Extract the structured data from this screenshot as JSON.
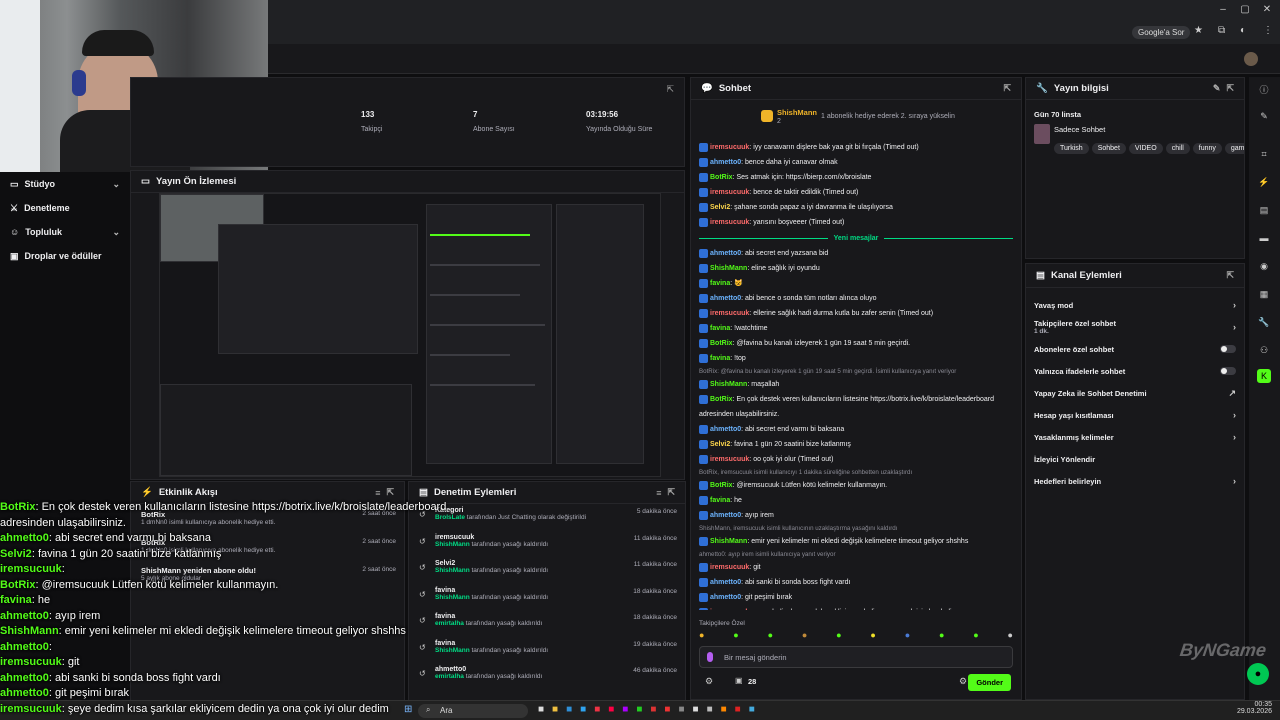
{
  "browser": {
    "google_chip": "Google'a Sor"
  },
  "nav": {
    "items": [
      {
        "label": "Stüdyo"
      },
      {
        "label": "Denetleme"
      },
      {
        "label": "Topluluk"
      },
      {
        "label": "Droplar ve ödüller"
      }
    ]
  },
  "stats": [
    {
      "value": "133",
      "label": "Takipçi"
    },
    {
      "value": "7",
      "label": "Abone Sayısı"
    },
    {
      "value": "03:19:56",
      "label": "Yayında Olduğu Süre"
    }
  ],
  "preview": {
    "title": "Yayın Ön İzlemesi"
  },
  "activity": {
    "title": "Etkinlik Akışı",
    "items": [
      {
        "title": "BotRix",
        "sub": "1 dmNn0 isimli kullanıcıya abonelik hediye etti.",
        "time": "2 saat önce"
      },
      {
        "title": "BotRix",
        "sub": "1 dmNn0 isimli kullanıcıya abonelik hediye etti.",
        "time": "2 saat önce"
      },
      {
        "title": "ShishMann yeniden abone oldu!",
        "sub": "5 aylık abone oldular",
        "time": "2 saat önce"
      }
    ]
  },
  "modlog": {
    "title": "Denetim Eylemleri",
    "rows": [
      {
        "name": "Kategori",
        "by": "BrolsLate",
        "action": "tarafından Just Chatting olarak değiştirildi",
        "time": "5 dakika önce"
      },
      {
        "name": "iremsucuuk",
        "by": "ShishMann",
        "action": "tarafından yasağı kaldırıldı",
        "time": "11 dakika önce"
      },
      {
        "name": "Selvi2",
        "by": "ShishMann",
        "action": "tarafından yasağı kaldırıldı",
        "time": "11 dakika önce"
      },
      {
        "name": "favina",
        "by": "ShishMann",
        "action": "tarafından yasağı kaldırıldı",
        "time": "18 dakika önce"
      },
      {
        "name": "favina",
        "by": "emirtalha",
        "action": "tarafından yasağı kaldırıldı",
        "time": "18 dakika önce"
      },
      {
        "name": "favina",
        "by": "ShishMann",
        "action": "tarafından yasağı kaldırıldı",
        "time": "19 dakika önce"
      },
      {
        "name": "ahmetto0",
        "by": "emirtalha",
        "action": "tarafından yasağı kaldırıldı",
        "time": "46 dakika önce"
      }
    ]
  },
  "chat": {
    "title": "Sohbet",
    "pinned_user": "ShishMann",
    "pinned_count": "2",
    "pinned_text": "1 abonelik hediye ederek 2. sıraya yükselin",
    "new_messages": "Yeni mesajlar",
    "input_placeholder": "Bir mesaj gönderin",
    "viewers": "28",
    "send_label": "Gönder",
    "followers_only": "Takipçilere Özel",
    "messages_top": [
      {
        "user": "iremsucuuk",
        "color": "#ff6b6b",
        "text": "iyy canavarın dişlere bak yaa git bi fırçala (Timed out)"
      },
      {
        "user": "ahmetto0",
        "color": "#6cb4ff",
        "text": "bence daha iyi canavar olmak"
      },
      {
        "user": "BotRix",
        "color": "#53fc18",
        "text": "Ses atmak için: https://bierp.com/x/broislate"
      },
      {
        "user": "iremsucuuk",
        "color": "#ff6b6b",
        "text": "bence de taktir edildik (Timed out)"
      },
      {
        "user": "Selvi2",
        "color": "#ffd84d",
        "text": "şahane sonda papaz a iyi davranma ile ulaşılıyorsa"
      },
      {
        "user": "iremsucuuk",
        "color": "#ff6b6b",
        "text": "yarısını boşveeer (Timed out)"
      }
    ],
    "messages_bottom": [
      {
        "user": "ahmetto0",
        "color": "#6cb4ff",
        "text": "abi secret end yazsana bid"
      },
      {
        "user": "ShishMann",
        "color": "#53fc18",
        "text": "eline sağlık iyi oyundu"
      },
      {
        "user": "favina",
        "color": "#53fc18",
        "text": "😺"
      },
      {
        "user": "ahmetto0",
        "color": "#6cb4ff",
        "text": "abi bence o sonda tüm notları alınca oluyo"
      },
      {
        "user": "iremsucuuk",
        "color": "#ff6b6b",
        "text": "ellerine sağlık hadi durma kutla bu zafer senin (Timed out)"
      },
      {
        "user": "favina",
        "color": "#53fc18",
        "text": "!watchtime"
      },
      {
        "user": "BotRix",
        "color": "#53fc18",
        "text": "@favina bu kanalı izleyerek 1 gün 19 saat 5 min geçirdi."
      },
      {
        "user": "favina",
        "color": "#53fc18",
        "text": "!top"
      },
      {
        "reply": "BotRix: @favina bu kanalı izleyerek 1 gün 19 saat 5 min geçirdi. İsimli kullanıcıya yanıt veriyor"
      },
      {
        "user": "ShishMann",
        "color": "#53fc18",
        "text": "maşallah"
      },
      {
        "user": "BotRix",
        "color": "#53fc18",
        "text": "En çok destek veren kullanıcıların listesine https://botrix.live/k/broislate/leaderboard"
      },
      {
        "text_only": "adresinden ulaşabilirsiniz."
      },
      {
        "user": "ahmetto0",
        "color": "#6cb4ff",
        "text": "abi secret end varmı bi baksana"
      },
      {
        "user": "Selvi2",
        "color": "#ffd84d",
        "text": "favina 1 gün 20 saatini bize katlanmış"
      },
      {
        "user": "iremsucuuk",
        "color": "#ff6b6b",
        "text": "oo çok iyi olur (Timed out)"
      },
      {
        "reply": "BotRix, iremsucuuk isimli kullanıcıyı 1 dakika süreliğine sohbetten uzaklaştırdı"
      },
      {
        "user": "BotRix",
        "color": "#53fc18",
        "text": "@iremsucuuk Lütfen kötü kelimeler kullanmayın."
      },
      {
        "user": "favina",
        "color": "#53fc18",
        "text": "he"
      },
      {
        "user": "ahmetto0",
        "color": "#6cb4ff",
        "text": "ayıp irem"
      },
      {
        "reply": "ShishMann, iremsucuuk isimli kullanıcının uzaklaştırma yasağını kaldırdı"
      },
      {
        "user": "ShishMann",
        "color": "#53fc18",
        "text": "emir yeni kelimeler mi ekledi değişik kelimelere timeout geliyor shshhs"
      },
      {
        "reply": "ahmetto0: ayıp irem isimli kullanıcıya yanıt veriyor"
      },
      {
        "user": "iremsucuuk",
        "color": "#ff6b6b",
        "text": "git"
      },
      {
        "user": "ahmetto0",
        "color": "#6cb4ff",
        "text": "abi sanki bi sonda boss fight vardı"
      },
      {
        "user": "ahmetto0",
        "color": "#6cb4ff",
        "text": "git peşimi bırak"
      },
      {
        "user": "iremsucuuk",
        "color": "#ff6b6b",
        "text": "şeye dedim kısa şarkılar ekliyicem dedin ya ona çok iyi olur dedim"
      }
    ]
  },
  "stream_info": {
    "title": "Yayın bilgisi",
    "stream_title": "Gün 70 linsta",
    "category": "Sadece Sohbet",
    "tags": [
      "Turkish",
      "Sohbet",
      "VIDEO",
      "chill",
      "funny",
      "gamin"
    ]
  },
  "channel_actions": {
    "title": "Kanal Eylemleri",
    "items": [
      {
        "label": "Yavaş mod",
        "kind": "chevron"
      },
      {
        "label": "Takipçilere özel sohbet",
        "sub": "1 dk.",
        "kind": "chevron"
      },
      {
        "label": "Abonelere özel sohbet",
        "kind": "toggle"
      },
      {
        "label": "Yalnızca ifadelerle sohbet",
        "kind": "toggle"
      },
      {
        "label": "Yapay Zeka ile Sohbet Denetimi",
        "kind": "external"
      },
      {
        "label": "Hesap yaşı kısıtlaması",
        "kind": "chevron"
      },
      {
        "label": "Yasaklanmış kelimeler",
        "kind": "chevron"
      },
      {
        "label": "İzleyici Yönlendir",
        "kind": "none"
      },
      {
        "label": "Hedefleri belirleyin",
        "kind": "chevron"
      }
    ]
  },
  "overlay_chat": [
    {
      "user": "BotRix",
      "text": "En çok destek veren kullanıcıların listesine https://botrix.live/k/broislate/leaderboard"
    },
    {
      "user": "",
      "text": "adresinden ulaşabilirsiniz."
    },
    {
      "user": "ahmetto0",
      "text": "abi secret end varmı bi baksana"
    },
    {
      "user": "Selvi2",
      "text": "favina 1 gün 20 saatini bize katlanmış"
    },
    {
      "user": "iremsucuuk",
      "text": ""
    },
    {
      "user": "BotRix",
      "text": "@iremsucuuk Lütfen kötü kelimeler kullanmayın."
    },
    {
      "user": "favina",
      "text": "he"
    },
    {
      "user": "ahmetto0",
      "text": "ayıp irem"
    },
    {
      "user": "ShishMann",
      "text": "emir yeni kelimeler mi ekledi değişik kelimelere timeout geliyor shshhs"
    },
    {
      "user": "ahmetto0",
      "text": ""
    },
    {
      "user": "iremsucuuk",
      "text": "git"
    },
    {
      "user": "ahmetto0",
      "text": "abi sanki bi sonda boss fight vardı"
    },
    {
      "user": "ahmetto0",
      "text": "git peşimi bırak"
    },
    {
      "user": "iremsucuuk",
      "text": "şeye dedim kısa şarkılar ekliyicem dedin ya ona çok iyi olur dedim"
    }
  ],
  "watermark": "ByNGame",
  "taskbar": {
    "search": "Ara",
    "time": "00:35",
    "date": "29.03.2026"
  }
}
